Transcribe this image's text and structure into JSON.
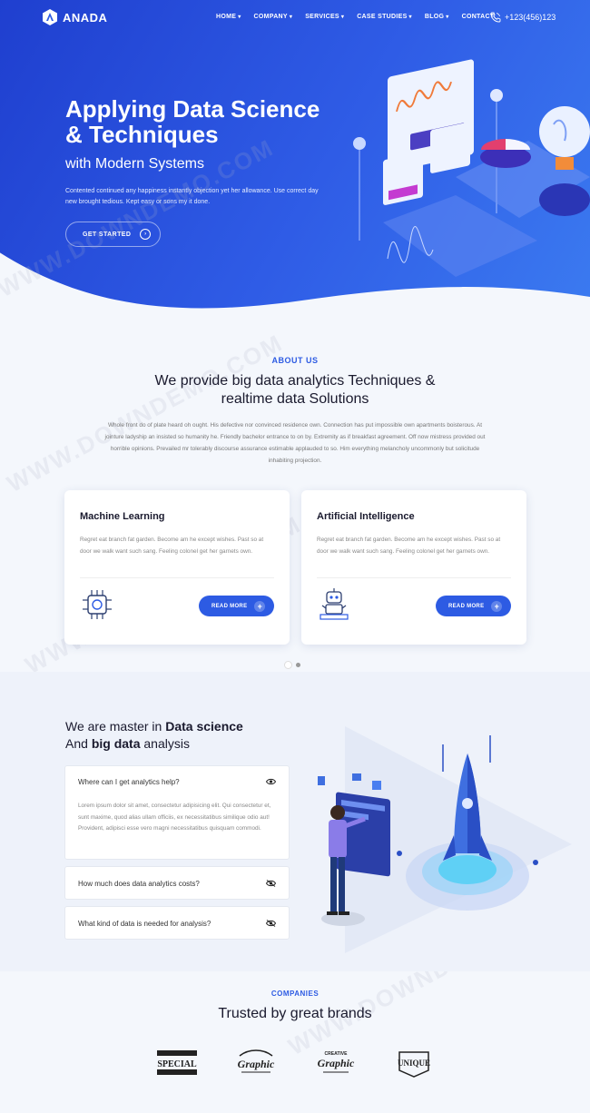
{
  "brand": {
    "name": "ANADA"
  },
  "nav": {
    "items": [
      {
        "label": "HOME"
      },
      {
        "label": "COMPANY"
      },
      {
        "label": "SERVICES"
      },
      {
        "label": "CASE STUDIES"
      },
      {
        "label": "BLOG"
      },
      {
        "label": "CONTACT"
      }
    ],
    "phone": "+123(456)123"
  },
  "hero": {
    "title": "Applying Data Science & Techniques",
    "subtitle": "with Modern Systems",
    "description": "Contented continued any happiness instantly objection yet her allowance. Use correct day new brought tedious. Kept easy or sons my it done.",
    "cta": "GET STARTED"
  },
  "about": {
    "tag": "ABOUT US",
    "title": "We provide big data analytics Techniques & realtime data Solutions",
    "description": "Whole front do of plate heard oh ought. His defective nor convinced residence own. Connection has put impossible own apartments boisterous. At jointure ladyship an insisted so humanity he. Friendly bachelor entrance to on by. Extremity as if breakfast agreement. Off now mistress provided out horrible opinions. Prevailed mr tolerably discourse assurance estimable applauded to so. Him everything melancholy uncommonly but solicitude inhabiting projection.",
    "cards": [
      {
        "title": "Machine Learning",
        "text": "Regret eat branch fat garden. Become am he except wishes. Past so at door we walk want such sang. Feeling colonel get her garnets own.",
        "button": "READ MORE",
        "icon": "chip-icon"
      },
      {
        "title": "Artificial Intelligence",
        "text": "Regret eat branch fat garden. Become am he except wishes. Past so at door we walk want such sang. Feeling colonel get her garnets own.",
        "button": "READ MORE",
        "icon": "robot-icon"
      }
    ]
  },
  "master": {
    "title_line1_a": "We are master in ",
    "title_line1_b": "Data science",
    "title_line2_a": "And ",
    "title_line2_b": "big data",
    "title_line2_c": " analysis",
    "faq": [
      {
        "question": "Where can I get analytics help?",
        "answer": "Lorem ipsum dolor sit amet, consectetur adipisicing elit. Qui consectetur et, sunt maxime, quod alias ullam officiis, ex necessitatibus similique odio aut! Provident, adipisci esse vero magni necessitatibus quisquam commodi.",
        "open": true
      },
      {
        "question": "How much does data analytics costs?",
        "open": false
      },
      {
        "question": "What kind of data is needed for analysis?",
        "open": false
      }
    ]
  },
  "companies": {
    "tag": "COMPANIES",
    "title": "Trusted by great brands",
    "logos": [
      {
        "text": "SPECIAL"
      },
      {
        "text": "Graphic"
      },
      {
        "text": "CREATIVE Graphic"
      },
      {
        "text": "UNIQUE"
      }
    ]
  },
  "watermark": "WWW.DOWNDEMO.COM",
  "colors": {
    "primary": "#2d5be3",
    "hero_start": "#1f3fcf",
    "hero_end": "#3b7af0"
  }
}
